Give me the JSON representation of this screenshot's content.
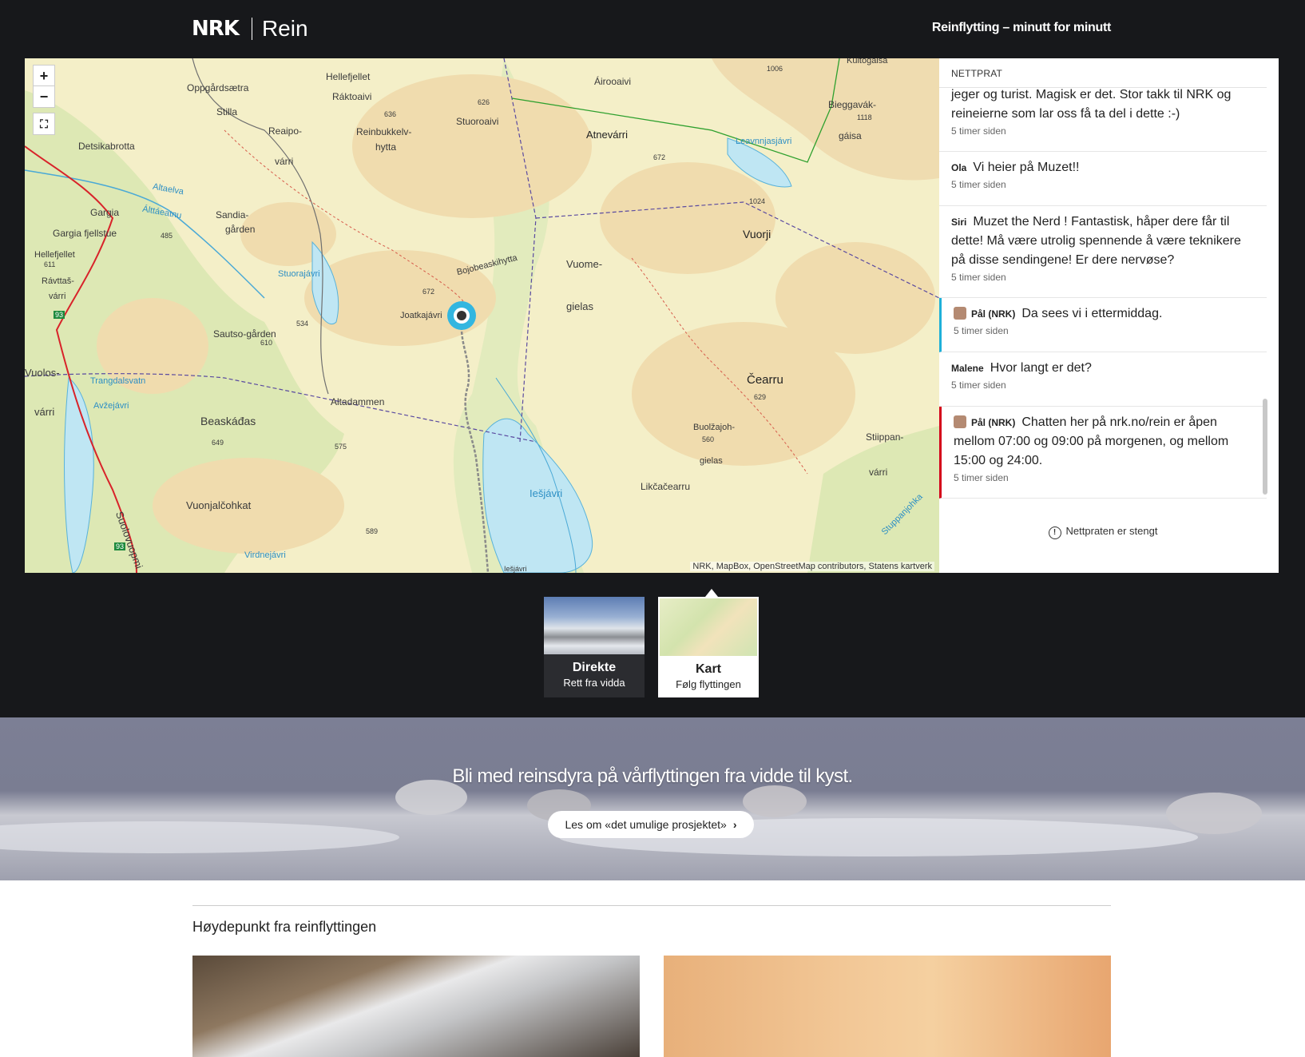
{
  "header": {
    "logo": "NRK",
    "site_name": "Rein",
    "nav_link": "Reinflytting – minutt for minutt"
  },
  "map": {
    "zoom_in": "+",
    "zoom_out": "−",
    "fullscreen": "⛶",
    "attribution": "NRK, MapBox, OpenStreetMap contributors, Statens kartverk",
    "labels": {
      "l1": "Oppgårdsætra",
      "l2": "Stilla",
      "l3": "Detsikabrotta",
      "l4": "Hellefjellet",
      "l5": "Ráktoaivi",
      "l6": "Reaipo-",
      "l7": "várri",
      "l8": "Reinbukkelv-",
      "l9": "hytta",
      "l10": "Stuoroaivi",
      "l11": "Áirooaivi",
      "l12": "Atnevárri",
      "l13": "Bieggavák-",
      "l14": "gáisa",
      "l15": "Leavnnjasjávri",
      "l16": "Vuorji",
      "l17": "Gargia",
      "l18": "Gargia fjellstue",
      "l19": "Sandia-",
      "l20": "gården",
      "l21": "Hellefjellet",
      "l22": "Rávttaš-",
      "l23": "várri",
      "l24": "Bojobeaskihytta",
      "l25": "Joatkajávri",
      "l26": "Vuome-",
      "l27": "gielas",
      "l28": "Sautso-gården",
      "l29": "Stuorajávri",
      "l30": "Altaelva",
      "l31": "Álttáeatnu",
      "l32": "Trangdalsvatn",
      "l33": "Avžejávri",
      "l34": "Vuolos-",
      "l35": "várri",
      "l36": "Altadammen",
      "l37": "Beaskáđas",
      "l38": "Čearru",
      "l39": "Buolžajoh-",
      "l40": "gielas",
      "l41": "Stiippan-",
      "l42": "várri",
      "l43": "Likčačearru",
      "l44": "Iešjávri",
      "l45": "Vuonjalčohkat",
      "l46": "Suolovuopmi",
      "l47": "Virdnejávri",
      "l48": "Stuppanjohka",
      "l49": "Kultogaisa",
      "l50": "Iešjávri",
      "n626": "626",
      "n636": "636",
      "n672a": "672",
      "n1024": "1024",
      "n1006": "1006",
      "n1118": "1118",
      "n485": "485",
      "n611": "611",
      "n672b": "672",
      "n534": "534",
      "n610": "610",
      "n629": "629",
      "n560": "560",
      "n649": "649",
      "n575": "575",
      "n589": "589",
      "road93a": "93",
      "road93b": "93"
    }
  },
  "chat": {
    "title": "NETTPRAT",
    "messages": [
      {
        "author": "",
        "text": "jeger og turist. Magisk er det. Stor takk til NRK og reineierne som lar oss få ta del i dette :-)",
        "time": "5 timer siden"
      },
      {
        "author": "Ola",
        "text": "Vi heier på Muzet!!",
        "time": "5 timer siden"
      },
      {
        "author": "Siri",
        "text": "Muzet the Nerd ! Fantastisk, håper dere får til dette! Må være utrolig spennende å være teknikere på disse sendingene! Er dere nervøse?",
        "time": "5 timer siden"
      },
      {
        "author": "Pål (NRK)",
        "text": "Da sees vi i ettermiddag.",
        "time": "5 timer siden"
      },
      {
        "author": "Malene",
        "text": "Hvor langt er det?",
        "time": "5 timer siden"
      },
      {
        "author": "Pål (NRK)",
        "text": "Chatten her på nrk.no/rein er åpen mellom 07:00 og 09:00 på morgenen, og mellom 15:00 og 24:00.",
        "time": "5 timer siden"
      }
    ],
    "closed_notice": "Nettpraten er stengt",
    "closed_icon": "!"
  },
  "tabs": [
    {
      "title": "Direkte",
      "subtitle": "Rett fra vidda"
    },
    {
      "title": "Kart",
      "subtitle": "Følg flyttingen"
    }
  ],
  "banner": {
    "headline": "Bli med reinsdyra på vårflyttingen fra vidde til kyst.",
    "button_label": "Les om «det umulige prosjektet»",
    "button_icon": "›"
  },
  "highlights": {
    "title": "Høydepunkt fra reinflyttingen"
  },
  "colors": {
    "header_bg": "#17181b",
    "chat_host_blue": "#1fb0d8",
    "chat_host_red": "#d4001a",
    "map_land": "#f4efc8",
    "map_water": "#bfe6f3"
  }
}
